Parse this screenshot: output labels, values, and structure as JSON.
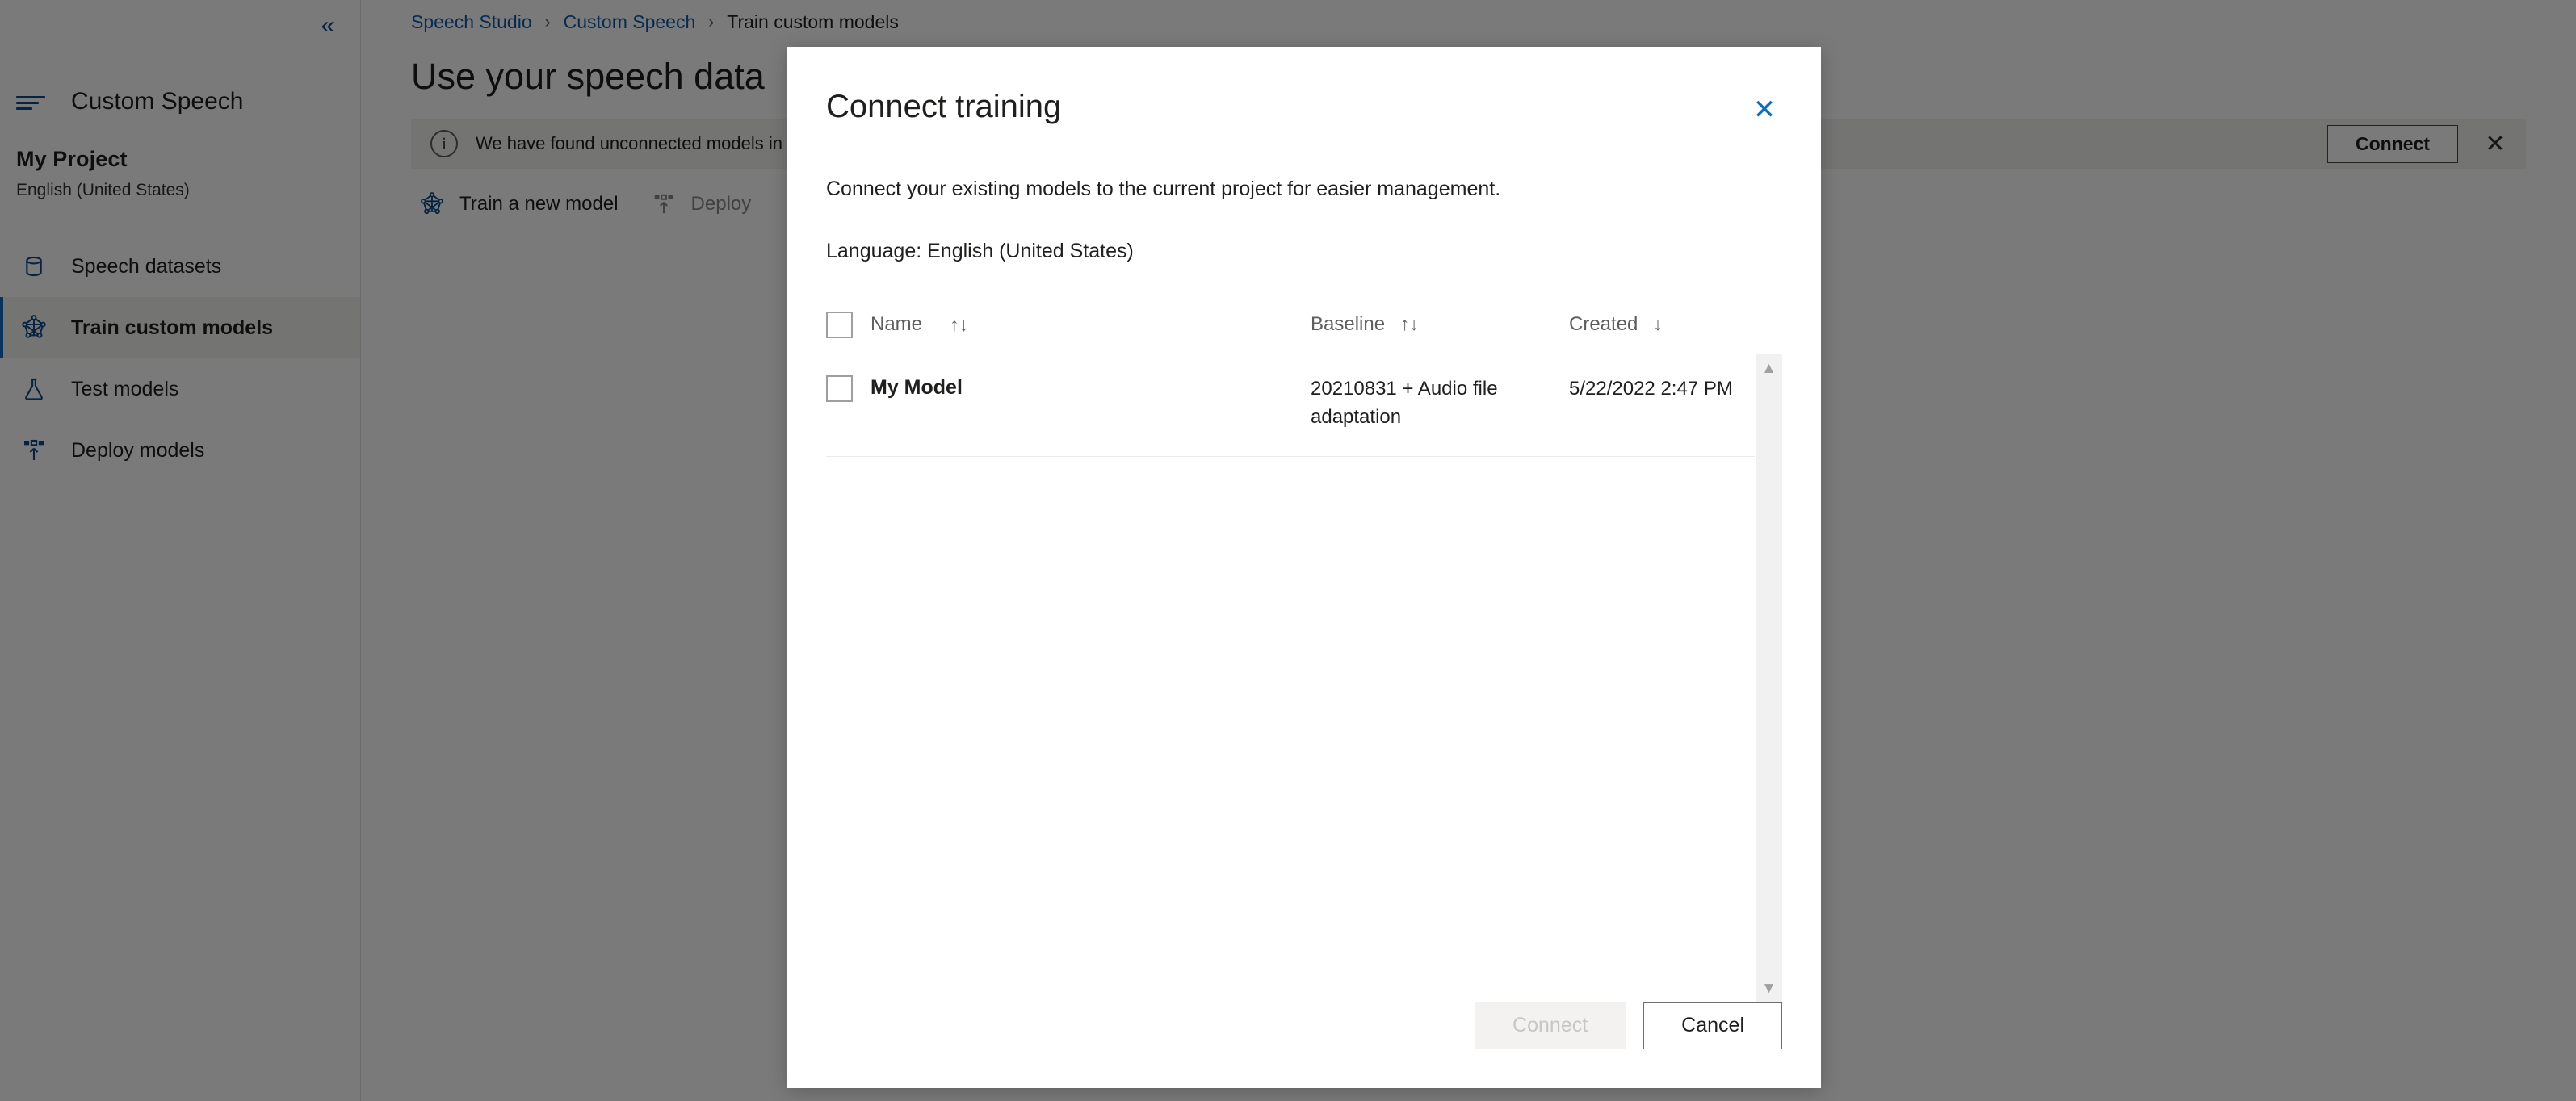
{
  "colors": {
    "accent": "#0f6cbd",
    "link": "#0f5ba7",
    "icon_blue": "#0f4a8a",
    "text": "#201f1e",
    "muted": "#605e5c",
    "scrim": "rgba(0,0,0,0.52)",
    "nav_active_bg": "#f3f2f1"
  },
  "sidebar": {
    "collapse_glyph": "«",
    "brand_label": "Custom Speech",
    "project_name": "My Project",
    "project_language": "English (United States)",
    "items": [
      {
        "label": "Speech datasets",
        "icon": "database-icon",
        "active": false
      },
      {
        "label": "Train custom models",
        "icon": "model-graph-icon",
        "active": true
      },
      {
        "label": "Test models",
        "icon": "flask-icon",
        "active": false
      },
      {
        "label": "Deploy models",
        "icon": "deploy-icon",
        "active": false
      }
    ]
  },
  "breadcrumb": {
    "items": [
      "Speech Studio",
      "Custom Speech",
      "Train custom models"
    ],
    "separator": "›"
  },
  "page": {
    "title": "Use your speech data"
  },
  "notice": {
    "icon": "info-icon",
    "message": "We have found unconnected models in this region. Do you want to connect these entities to this project so you can ...",
    "connect_label": "Connect",
    "close_glyph": "✕"
  },
  "commandbar": {
    "items": [
      {
        "label": "Train a new model",
        "icon": "model-graph-icon",
        "disabled": false
      },
      {
        "label": "Deploy",
        "icon": "deploy-icon",
        "disabled": true
      }
    ]
  },
  "dialog": {
    "title": "Connect training",
    "close_glyph": "✕",
    "description": "Connect your existing models to the current project for easier management.",
    "language_line": "Language: English (United States)",
    "table": {
      "columns": [
        {
          "key": "name",
          "label": "Name",
          "sort_glyph": "↑↓"
        },
        {
          "key": "baseline",
          "label": "Baseline",
          "sort_glyph": "↑↓"
        },
        {
          "key": "created",
          "label": "Created",
          "sort_glyph": "↓"
        }
      ],
      "select_all_checked": false,
      "rows": [
        {
          "selected": false,
          "name": "My Model",
          "baseline": "20210831 + Audio file adaptation",
          "created": "5/22/2022 2:47 PM"
        }
      ],
      "scrollbar": {
        "up_glyph": "▲",
        "down_glyph": "▼"
      }
    },
    "footer": {
      "connect_label": "Connect",
      "connect_disabled": true,
      "cancel_label": "Cancel"
    }
  }
}
